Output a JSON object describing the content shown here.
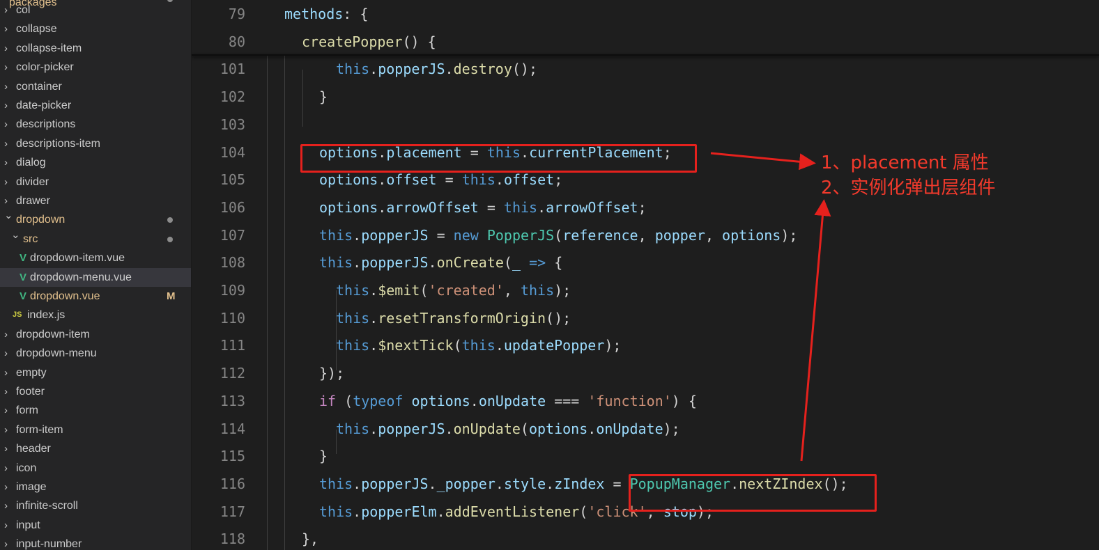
{
  "sidebar": {
    "root_label": "packages",
    "items": [
      {
        "label": "col"
      },
      {
        "label": "collapse"
      },
      {
        "label": "collapse-item"
      },
      {
        "label": "color-picker"
      },
      {
        "label": "container"
      },
      {
        "label": "date-picker"
      },
      {
        "label": "descriptions"
      },
      {
        "label": "descriptions-item"
      },
      {
        "label": "dialog"
      },
      {
        "label": "divider"
      },
      {
        "label": "drawer"
      },
      {
        "label": "dropdown"
      },
      {
        "label": "src"
      },
      {
        "label": "dropdown-item.vue"
      },
      {
        "label": "dropdown-menu.vue"
      },
      {
        "label": "dropdown.vue",
        "badge": "M"
      },
      {
        "label": "index.js",
        "icon_text": "JS"
      },
      {
        "label": "dropdown-item"
      },
      {
        "label": "dropdown-menu"
      },
      {
        "label": "empty"
      },
      {
        "label": "footer"
      },
      {
        "label": "form"
      },
      {
        "label": "form-item"
      },
      {
        "label": "header"
      },
      {
        "label": "icon"
      },
      {
        "label": "image"
      },
      {
        "label": "infinite-scroll"
      },
      {
        "label": "input"
      },
      {
        "label": "input-number"
      }
    ]
  },
  "editor": {
    "lines": [
      {
        "n": "79",
        "tokens": [
          [
            "v",
            "methods"
          ],
          [
            "p",
            ": {"
          ]
        ]
      },
      {
        "n": "80",
        "tokens": [
          [
            "fn",
            "createPopper"
          ],
          [
            "p",
            "() {"
          ]
        ]
      },
      {
        "n": "101",
        "tokens": [
          [
            "k",
            "this"
          ],
          [
            "p",
            "."
          ],
          [
            "v",
            "popperJS"
          ],
          [
            "p",
            "."
          ],
          [
            "fn",
            "destroy"
          ],
          [
            "p",
            "();"
          ]
        ]
      },
      {
        "n": "102",
        "tokens": [
          [
            "p",
            "}"
          ]
        ]
      },
      {
        "n": "103",
        "tokens": []
      },
      {
        "n": "104",
        "tokens": [
          [
            "v",
            "options"
          ],
          [
            "p",
            "."
          ],
          [
            "v",
            "placement"
          ],
          [
            "p",
            " = "
          ],
          [
            "k",
            "this"
          ],
          [
            "p",
            "."
          ],
          [
            "v",
            "currentPlacement"
          ],
          [
            "p",
            ";"
          ]
        ]
      },
      {
        "n": "105",
        "tokens": [
          [
            "v",
            "options"
          ],
          [
            "p",
            "."
          ],
          [
            "v",
            "offset"
          ],
          [
            "p",
            " = "
          ],
          [
            "k",
            "this"
          ],
          [
            "p",
            "."
          ],
          [
            "v",
            "offset"
          ],
          [
            "p",
            ";"
          ]
        ]
      },
      {
        "n": "106",
        "tokens": [
          [
            "v",
            "options"
          ],
          [
            "p",
            "."
          ],
          [
            "v",
            "arrowOffset"
          ],
          [
            "p",
            " = "
          ],
          [
            "k",
            "this"
          ],
          [
            "p",
            "."
          ],
          [
            "v",
            "arrowOffset"
          ],
          [
            "p",
            ";"
          ]
        ]
      },
      {
        "n": "107",
        "tokens": [
          [
            "k",
            "this"
          ],
          [
            "p",
            "."
          ],
          [
            "v",
            "popperJS"
          ],
          [
            "p",
            " = "
          ],
          [
            "k",
            "new"
          ],
          [
            "p",
            " "
          ],
          [
            "cls",
            "PopperJS"
          ],
          [
            "p",
            "("
          ],
          [
            "v",
            "reference"
          ],
          [
            "p",
            ", "
          ],
          [
            "v",
            "popper"
          ],
          [
            "p",
            ", "
          ],
          [
            "v",
            "options"
          ],
          [
            "p",
            ");"
          ]
        ]
      },
      {
        "n": "108",
        "tokens": [
          [
            "k",
            "this"
          ],
          [
            "p",
            "."
          ],
          [
            "v",
            "popperJS"
          ],
          [
            "p",
            "."
          ],
          [
            "fn",
            "onCreate"
          ],
          [
            "p",
            "("
          ],
          [
            "v",
            "_"
          ],
          [
            "p",
            " "
          ],
          [
            "k",
            "=>"
          ],
          [
            "p",
            " {"
          ]
        ]
      },
      {
        "n": "109",
        "tokens": [
          [
            "k",
            "this"
          ],
          [
            "p",
            "."
          ],
          [
            "fn",
            "$emit"
          ],
          [
            "p",
            "("
          ],
          [
            "str",
            "'created'"
          ],
          [
            "p",
            ", "
          ],
          [
            "k",
            "this"
          ],
          [
            "p",
            ");"
          ]
        ]
      },
      {
        "n": "110",
        "tokens": [
          [
            "k",
            "this"
          ],
          [
            "p",
            "."
          ],
          [
            "fn",
            "resetTransformOrigin"
          ],
          [
            "p",
            "();"
          ]
        ]
      },
      {
        "n": "111",
        "tokens": [
          [
            "k",
            "this"
          ],
          [
            "p",
            "."
          ],
          [
            "fn",
            "$nextTick"
          ],
          [
            "p",
            "("
          ],
          [
            "k",
            "this"
          ],
          [
            "p",
            "."
          ],
          [
            "v",
            "updatePopper"
          ],
          [
            "p",
            ");"
          ]
        ]
      },
      {
        "n": "112",
        "tokens": [
          [
            "p",
            "});"
          ]
        ]
      },
      {
        "n": "113",
        "tokens": [
          [
            "ctrl",
            "if"
          ],
          [
            "p",
            " ("
          ],
          [
            "k",
            "typeof"
          ],
          [
            "p",
            " "
          ],
          [
            "v",
            "options"
          ],
          [
            "p",
            "."
          ],
          [
            "v",
            "onUpdate"
          ],
          [
            "p",
            " === "
          ],
          [
            "str",
            "'function'"
          ],
          [
            "p",
            ") {"
          ]
        ]
      },
      {
        "n": "114",
        "tokens": [
          [
            "k",
            "this"
          ],
          [
            "p",
            "."
          ],
          [
            "v",
            "popperJS"
          ],
          [
            "p",
            "."
          ],
          [
            "fn",
            "onUpdate"
          ],
          [
            "p",
            "("
          ],
          [
            "v",
            "options"
          ],
          [
            "p",
            "."
          ],
          [
            "v",
            "onUpdate"
          ],
          [
            "p",
            ");"
          ]
        ]
      },
      {
        "n": "115",
        "tokens": [
          [
            "p",
            "}"
          ]
        ]
      },
      {
        "n": "116",
        "tokens": [
          [
            "k",
            "this"
          ],
          [
            "p",
            "."
          ],
          [
            "v",
            "popperJS"
          ],
          [
            "p",
            "."
          ],
          [
            "v",
            "_popper"
          ],
          [
            "p",
            "."
          ],
          [
            "v",
            "style"
          ],
          [
            "p",
            "."
          ],
          [
            "v",
            "zIndex"
          ],
          [
            "p",
            " = "
          ],
          [
            "cls",
            "PopupManager"
          ],
          [
            "p",
            "."
          ],
          [
            "fn",
            "nextZIndex"
          ],
          [
            "p",
            "();"
          ]
        ]
      },
      {
        "n": "117",
        "tokens": [
          [
            "k",
            "this"
          ],
          [
            "p",
            "."
          ],
          [
            "v",
            "popperElm"
          ],
          [
            "p",
            "."
          ],
          [
            "fn",
            "addEventListener"
          ],
          [
            "p",
            "("
          ],
          [
            "str",
            "'click'"
          ],
          [
            "p",
            ", "
          ],
          [
            "v",
            "stop"
          ],
          [
            "p",
            ");"
          ]
        ]
      },
      {
        "n": "118",
        "tokens": [
          [
            "p",
            "},"
          ]
        ]
      }
    ]
  },
  "annotations": {
    "note1": "1、placement 属性",
    "note2": "2、实例化弹出层组件",
    "color": "#e5211d"
  }
}
